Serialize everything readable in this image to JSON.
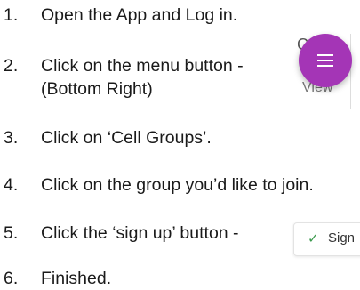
{
  "steps": [
    {
      "number": "1.",
      "lines": [
        "Open the App and Log in."
      ]
    },
    {
      "number": "2.",
      "lines": [
        "Click on the menu button -",
        "(Bottom Right)"
      ]
    },
    {
      "number": "3.",
      "lines": [
        "Click on ‘Cell Groups’."
      ]
    },
    {
      "number": "4.",
      "lines": [
        "Click on the group you’d like to join."
      ]
    },
    {
      "number": "5.",
      "lines": [
        "Click the ‘sign up’ button -"
      ]
    },
    {
      "number": "6.",
      "lines": [
        "Finished."
      ]
    }
  ],
  "menu_snippet": {
    "fragment_top": "C",
    "fragment_bottom": "View",
    "icon": "hamburger-menu-icon",
    "fab_color": "#a435b6"
  },
  "signup_snippet": {
    "icon": "checkmark-icon",
    "label": "Sign",
    "check_color": "#3c9a4e"
  }
}
